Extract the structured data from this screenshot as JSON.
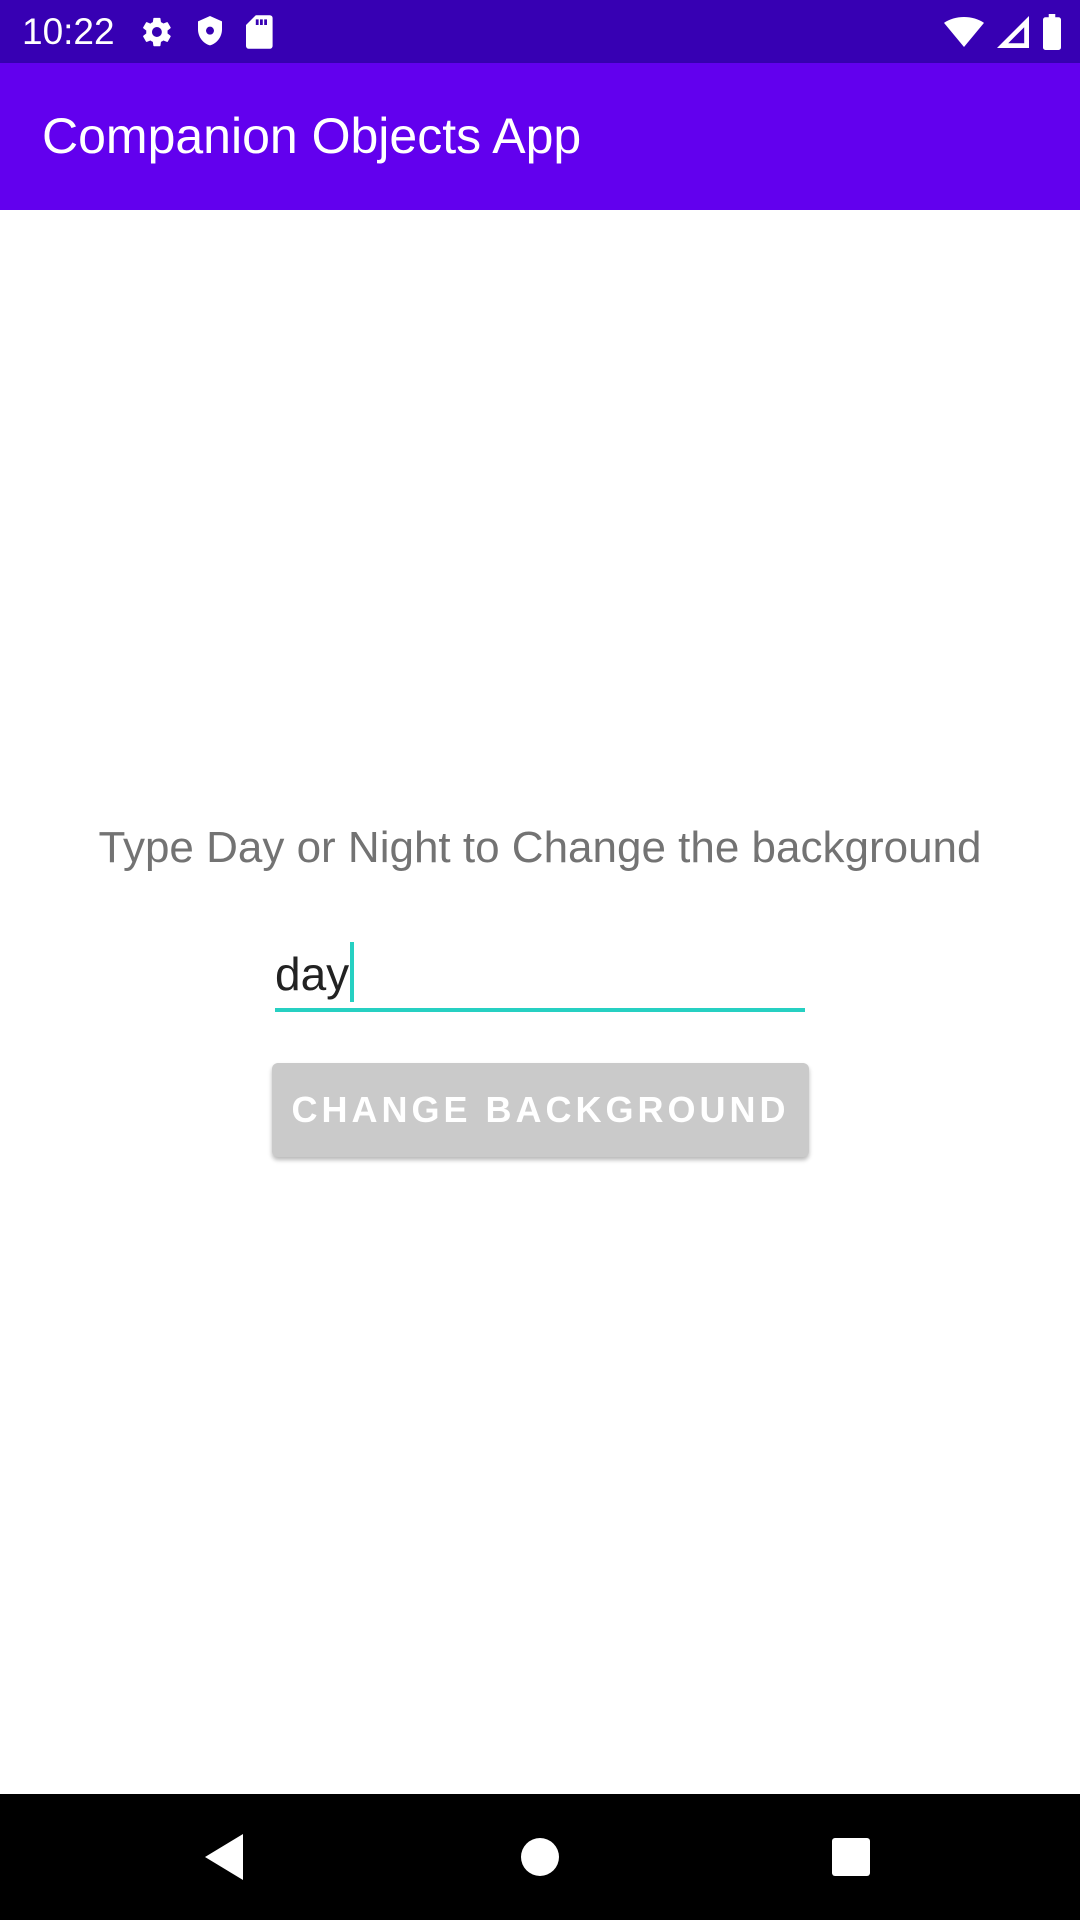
{
  "status_bar": {
    "time": "10:22",
    "icons_left": [
      "settings-gear-icon",
      "shield-icon",
      "sd-card-icon"
    ],
    "icons_right": [
      "wifi-icon",
      "cell-signal-icon",
      "battery-icon"
    ],
    "background_color": "#3700B3"
  },
  "app_bar": {
    "title": "Companion Objects App",
    "background_color": "#6200EE"
  },
  "main": {
    "prompt": "Type Day or Night to Change the background",
    "input": {
      "value": "day",
      "underline_color": "#26D0C2"
    },
    "button_label": "CHANGE BACKGROUND",
    "button_color": "#CACACA"
  },
  "nav_bar": {
    "buttons": [
      "back-icon",
      "home-icon",
      "recents-icon"
    ]
  }
}
